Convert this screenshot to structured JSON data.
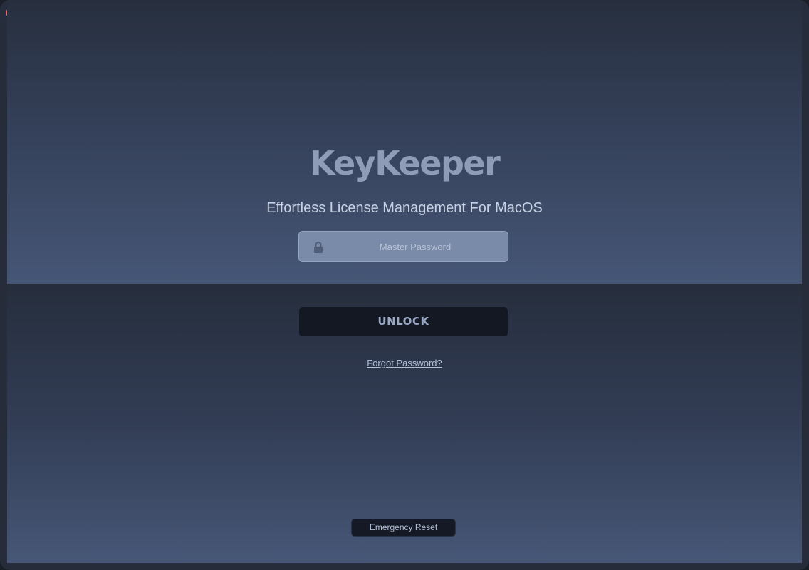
{
  "window": {
    "controls": [
      "close",
      "minimize",
      "maximize"
    ]
  },
  "app": {
    "title": "KeyKeeper",
    "subtitle": "Effortless License Management For MacOS"
  },
  "login": {
    "password_placeholder": "Master Password",
    "password_value": "",
    "unlock_label": "UNLOCK",
    "forgot_label": "Forgot Password?",
    "lock_icon": "lock-icon"
  },
  "footer": {
    "emergency_label": "Emergency Reset"
  },
  "colors": {
    "background_top": "#272f3e",
    "background_bottom": "#465676",
    "title_color": "#8e9cb7",
    "button_bg": "#131823",
    "field_bg": "#7a8aa9",
    "traffic_close": "#ff5f57",
    "traffic_minimize": "#febc2e",
    "traffic_maximize": "#28c840"
  }
}
